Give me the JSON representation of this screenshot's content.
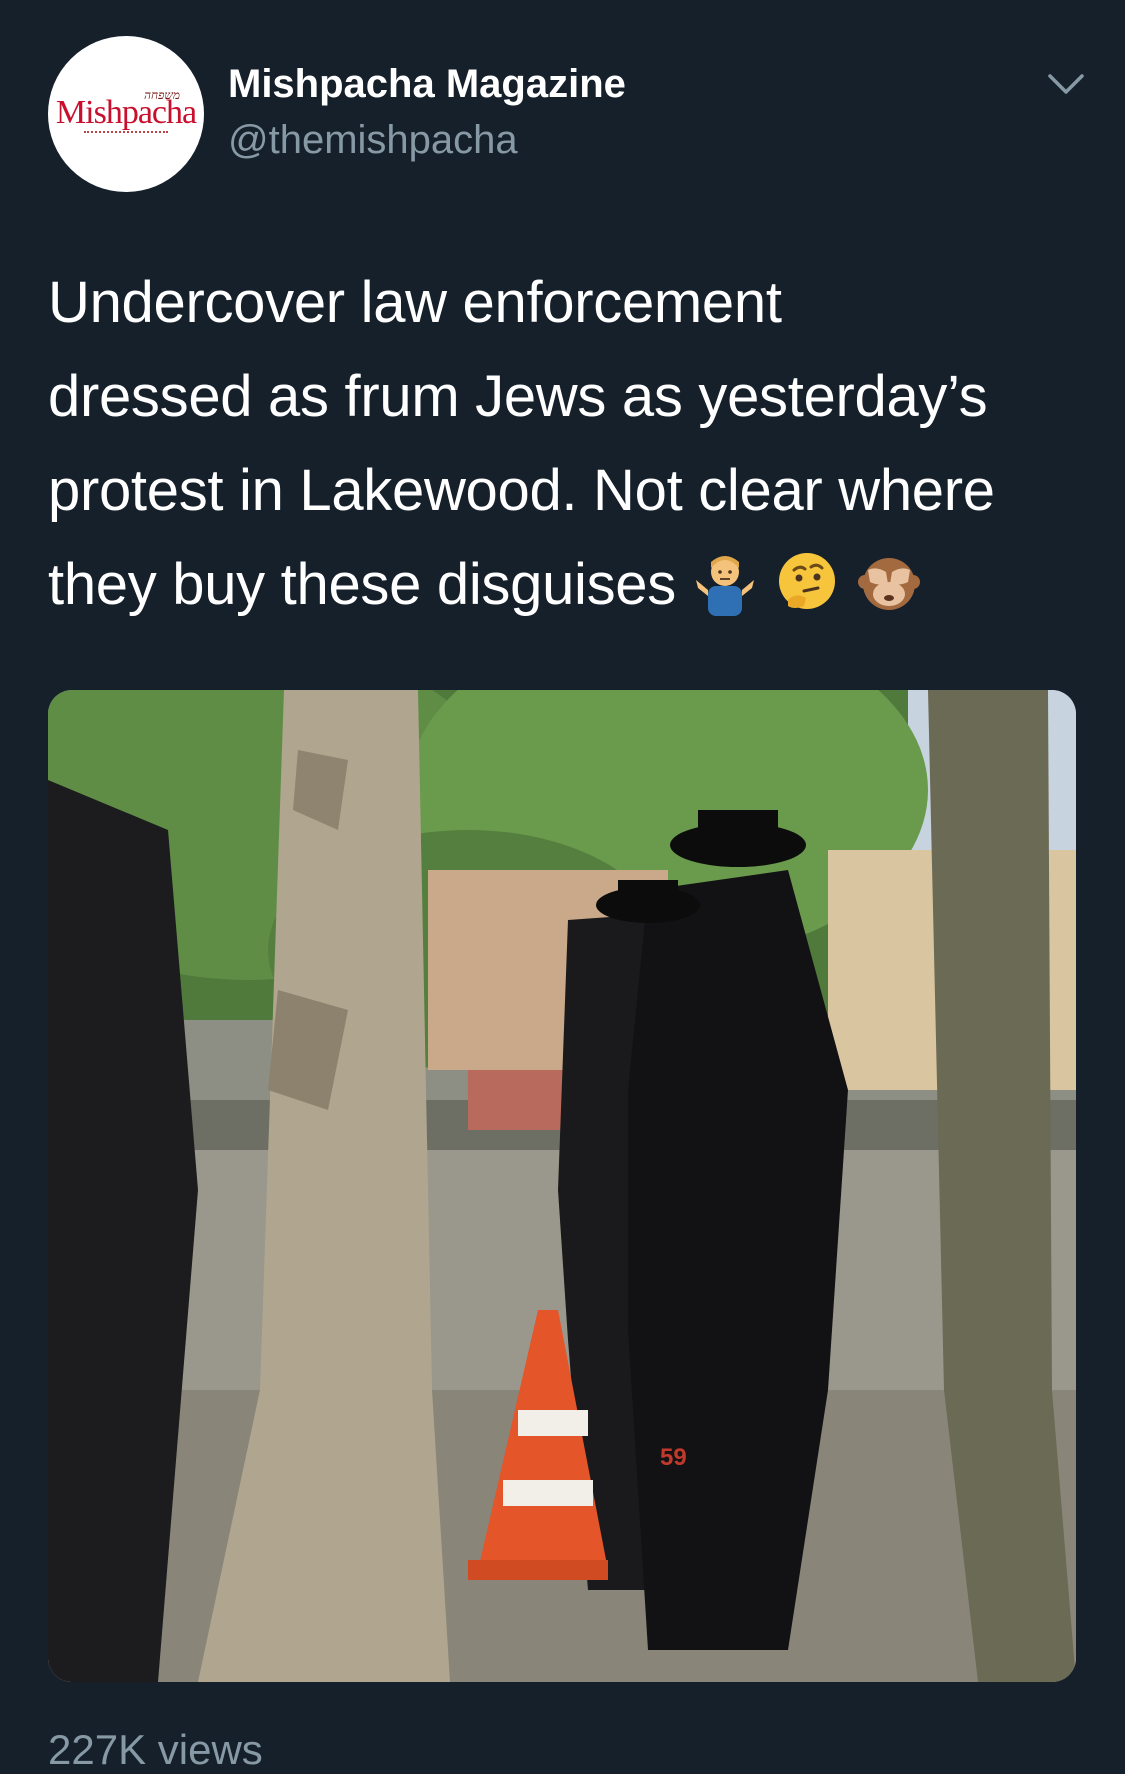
{
  "account": {
    "name": "Mishpacha Magazine",
    "handle": "@themishpacha",
    "avatar_logo": "Mishpacha",
    "avatar_logo_hebrew": "משפחה"
  },
  "tweet": {
    "text_lines": [
      "Undercover law enforcement",
      "dressed as frum Jews as yesterday’s",
      "protest in Lakewood. Not clear where",
      "they buy these disguises"
    ],
    "emojis": [
      "man-shrugging-emoji",
      "thinking-face-emoji",
      "see-no-evil-monkey-emoji"
    ]
  },
  "media": {
    "type": "video-still",
    "overlay_number": "59"
  },
  "footer": {
    "views": "227K views"
  },
  "icons": {
    "menu": "chevron-down-icon"
  },
  "colors": {
    "background": "#15202b",
    "secondary_text": "#8899a6",
    "primary_text": "#ffffff",
    "brand_red": "#c8102e"
  }
}
